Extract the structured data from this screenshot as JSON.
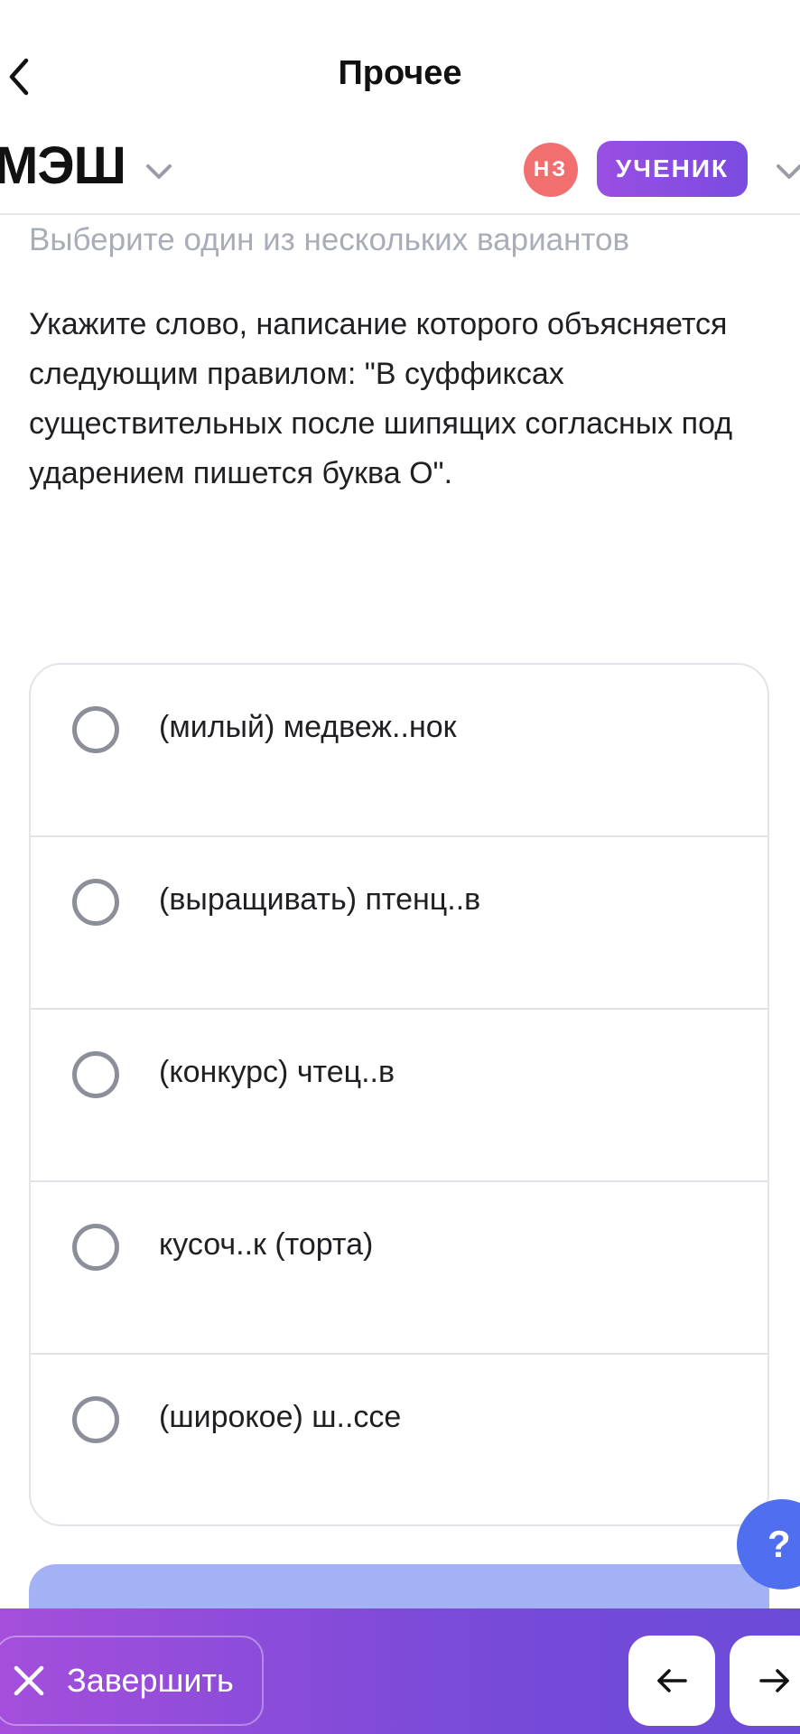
{
  "nav": {
    "title": "Прочее"
  },
  "header": {
    "logo": "МЭШ",
    "avatar_initials": "НЗ",
    "role_label": "УЧЕНИК"
  },
  "task": {
    "instruction": "Выберите один из нескольких вариантов",
    "question": "Укажите слово, написание которого объясняется следующим правилом: \"В суффиксах существительных после шипящих согласных под ударением пишется буква О\"."
  },
  "options": [
    {
      "label": "(милый) медвеж..нок"
    },
    {
      "label": "(выращивать) птенц..в"
    },
    {
      "label": "(конкурс) чтец..в"
    },
    {
      "label": "кусоч..к (торта)"
    },
    {
      "label": "(широкое) ш..ссе"
    }
  ],
  "help": {
    "label": "?"
  },
  "footer": {
    "finish_label": "Завершить"
  },
  "colors": {
    "accent_purple": "#9a4fe2",
    "avatar_red": "#f26f6f",
    "help_blue": "#4f6ff0",
    "submit_light_blue": "#a3b2f5"
  },
  "icons": {
    "back": "chevron-left-icon",
    "dropdown": "chevron-down-icon",
    "finish": "close-icon",
    "prev": "arrow-left-icon",
    "next": "arrow-right-icon"
  }
}
